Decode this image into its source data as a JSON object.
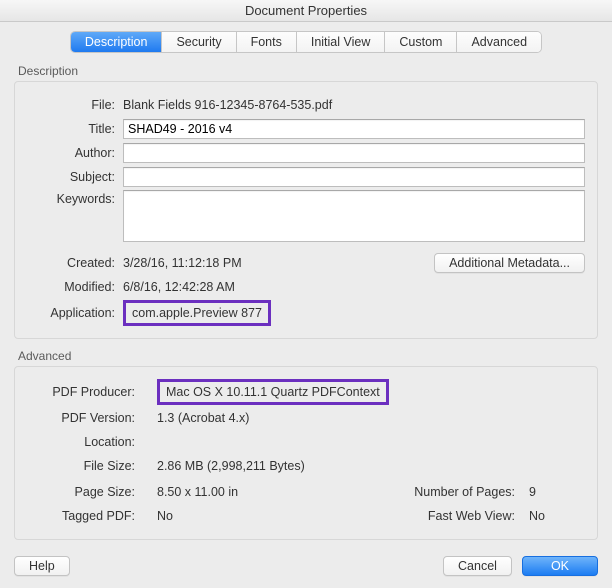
{
  "window": {
    "title": "Document Properties"
  },
  "tabs": {
    "description": "Description",
    "security": "Security",
    "fonts": "Fonts",
    "initial_view": "Initial View",
    "custom": "Custom",
    "advanced": "Advanced"
  },
  "desc": {
    "group_title": "Description",
    "file_label": "File:",
    "file_value": "Blank Fields 916-12345-8764-535.pdf",
    "title_label": "Title:",
    "title_value": "SHAD49 - 2016 v4",
    "author_label": "Author:",
    "author_value": "",
    "subject_label": "Subject:",
    "subject_value": "",
    "keywords_label": "Keywords:",
    "keywords_value": "",
    "created_label": "Created:",
    "created_value": "3/28/16, 11:12:18 PM",
    "modified_label": "Modified:",
    "modified_value": "6/8/16, 12:42:28 AM",
    "application_label": "Application:",
    "application_value": "com.apple.Preview 877",
    "additional_metadata": "Additional Metadata..."
  },
  "adv": {
    "group_title": "Advanced",
    "producer_label": "PDF Producer:",
    "producer_value": "Mac OS X 10.11.1 Quartz PDFContext",
    "version_label": "PDF Version:",
    "version_value": "1.3 (Acrobat 4.x)",
    "location_label": "Location:",
    "location_value": "",
    "filesize_label": "File Size:",
    "filesize_value": "2.86 MB (2,998,211 Bytes)",
    "pagesize_label": "Page Size:",
    "pagesize_value": "8.50 x 11.00 in",
    "numpages_label": "Number of Pages:",
    "numpages_value": "9",
    "tagged_label": "Tagged PDF:",
    "tagged_value": "No",
    "fastweb_label": "Fast Web View:",
    "fastweb_value": "No"
  },
  "buttons": {
    "help": "Help",
    "cancel": "Cancel",
    "ok": "OK"
  }
}
